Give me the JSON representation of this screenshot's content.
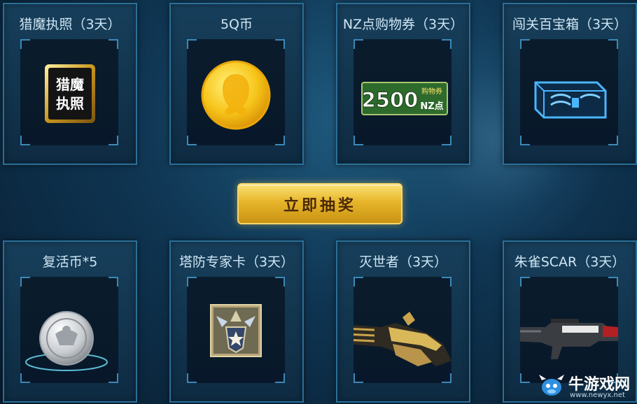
{
  "prizes_top": [
    {
      "title": "猎魔执照（3天）",
      "icon": "hunter-license-icon",
      "icon_text": [
        "猎魔",
        "执照"
      ]
    },
    {
      "title": "5Q币",
      "icon": "q-coin-icon"
    },
    {
      "title": "NZ点购物券（3天）",
      "icon": "nz-voucher-icon",
      "amount": "2500",
      "tag": "购物券",
      "unit": "NZ点"
    },
    {
      "title": "闯关百宝箱（3天）",
      "icon": "treasure-box-icon"
    }
  ],
  "draw_button": {
    "label": "立即抽奖"
  },
  "prizes_bottom": [
    {
      "title": "复活币*5",
      "icon": "revive-coin-icon"
    },
    {
      "title": "塔防专家卡（3天）",
      "icon": "tower-defense-card-icon"
    },
    {
      "title": "灭世者（3天）",
      "icon": "destroyer-weapon-icon"
    },
    {
      "title": "朱雀SCAR（3天）",
      "icon": "scar-rifle-icon"
    }
  ],
  "watermark": {
    "name": "牛游戏网",
    "url": "www.newyx.net"
  },
  "colors": {
    "accent": "#e7b52a",
    "frame": "#2a6f98",
    "bg": "#0f3552"
  }
}
